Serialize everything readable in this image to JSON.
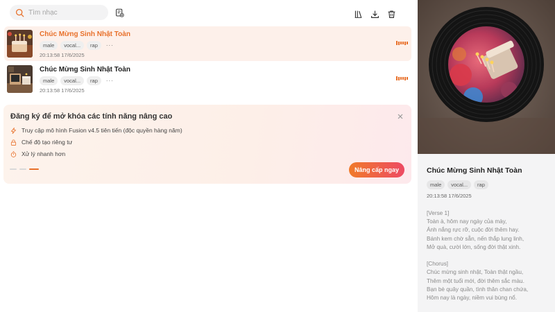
{
  "search": {
    "placeholder": "Tìm nhạc"
  },
  "toolbar": {
    "icons": [
      "playlist-add-icon",
      "library-icon",
      "download-icon",
      "trash-icon"
    ]
  },
  "songs": [
    {
      "title": "Chúc Mừng Sinh Nhật Toàn",
      "tags": [
        "male",
        "vocal...",
        "rap"
      ],
      "more": "···",
      "time": "20:13:58 17/6/2025",
      "active": true
    },
    {
      "title": "Chúc Mừng Sinh Nhật Toàn",
      "tags": [
        "male",
        "vocal...",
        "rap"
      ],
      "more": "···",
      "time": "20:13:58 17/6/2025",
      "active": false
    }
  ],
  "promo": {
    "title": "Đăng ký để mở khóa các tính năng nâng cao",
    "features": [
      {
        "icon": "lightning-icon",
        "text": "Truy cập mô hình Fusion v4.5 tiên tiến (độc quyền hàng năm)"
      },
      {
        "icon": "lock-icon",
        "text": "Chế độ tạo riêng tư"
      },
      {
        "icon": "stopwatch-icon",
        "text": "Xử lý nhanh hơn"
      }
    ],
    "button": "Nâng cấp ngay",
    "slides": 3,
    "active_slide": 3
  },
  "detail": {
    "title": "Chúc Mừng Sinh Nhật Toàn",
    "tags": [
      "male",
      "vocal...",
      "rap"
    ],
    "time": "20:13:58 17/6/2025",
    "lyrics": "[Verse 1]\nToàn à, hôm nay ngày của mày,\nÁnh nắng rực rỡ, cuộc đời thêm hay.\nBánh kem chờ sẵn, nến thắp lung linh,\nMở quà, cười lớn, sống đời thật xinh.\n\n[Chorus]\nChúc mừng sinh nhật, Toàn thật ngầu,\nThêm một tuổi mới, đời thêm sắc màu.\nBạn bè quây quần, tình thân chan chứa,\nHôm nay là ngày, niềm vui bùng nổ."
  },
  "colors": {
    "accent": "#e8702a",
    "button_gradient_start": "#f07a2a",
    "button_gradient_end": "#ed4a63",
    "active_row": "#fdf0ea"
  }
}
